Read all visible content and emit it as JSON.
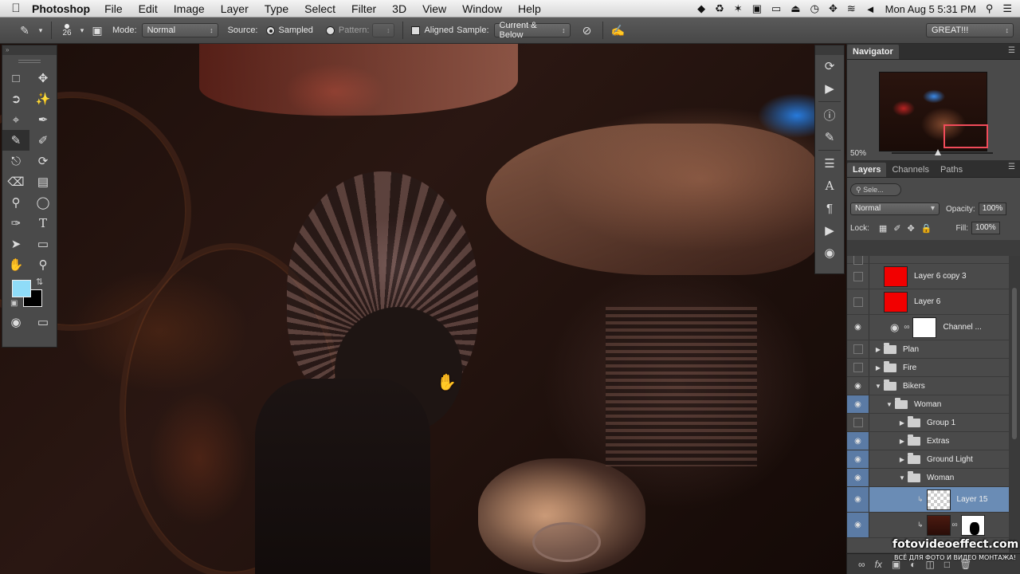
{
  "menubar": {
    "app": "Photoshop",
    "menus": [
      "File",
      "Edit",
      "Image",
      "Layer",
      "Type",
      "Select",
      "Filter",
      "3D",
      "View",
      "Window",
      "Help"
    ],
    "clock": "Mon Aug 5  5:31 PM"
  },
  "options": {
    "brush_size": "26",
    "mode_label": "Mode:",
    "mode_value": "Normal",
    "source_label": "Source:",
    "sampled_label": "Sampled",
    "pattern_label": "Pattern:",
    "aligned_label": "Aligned",
    "sample_label": "Sample:",
    "sample_value": "Current & Below",
    "workspace": "GREAT!!!"
  },
  "tools": {
    "foreground_color": "#8fdcf8",
    "background_color": "#000000"
  },
  "navigator": {
    "tab": "Navigator",
    "zoom": "50%",
    "zoom_slider_fraction": 0.46
  },
  "layers_panel": {
    "tabs": [
      "Layers",
      "Channels",
      "Paths"
    ],
    "filter_placeholder": "Sele...",
    "blend_mode": "Normal",
    "opacity_label": "Opacity:",
    "opacity": "100%",
    "lock_label": "Lock:",
    "fill_label": "Fill:",
    "fill": "100%",
    "layers": [
      {
        "name": "Layer 6 copy 3",
        "visible": false,
        "type": "red"
      },
      {
        "name": "Layer 6",
        "visible": false,
        "type": "red"
      },
      {
        "name": "Channel ...",
        "visible": true,
        "type": "adjustment"
      },
      {
        "name": "Plan",
        "visible": false,
        "type": "group"
      },
      {
        "name": "Fire",
        "visible": false,
        "type": "group"
      },
      {
        "name": "Bikers",
        "visible": true,
        "type": "group-open"
      },
      {
        "name": "Woman",
        "visible": true,
        "type": "group-open"
      },
      {
        "name": "Group 1",
        "visible": false,
        "type": "group"
      },
      {
        "name": "Extras",
        "visible": true,
        "type": "group"
      },
      {
        "name": "Ground Light",
        "visible": true,
        "type": "group"
      },
      {
        "name": "Woman",
        "visible": true,
        "type": "group-open"
      },
      {
        "name": "Layer 15",
        "visible": true,
        "type": "transparent",
        "selected": true
      },
      {
        "name": "",
        "visible": true,
        "type": "masked"
      }
    ],
    "footer_fx": "fx"
  },
  "watermark": {
    "main": "fotovideoeffect.com",
    "sub": "ВСЁ ДЛЯ ФОТО И ВИДЕО МОНТАЖА!"
  }
}
